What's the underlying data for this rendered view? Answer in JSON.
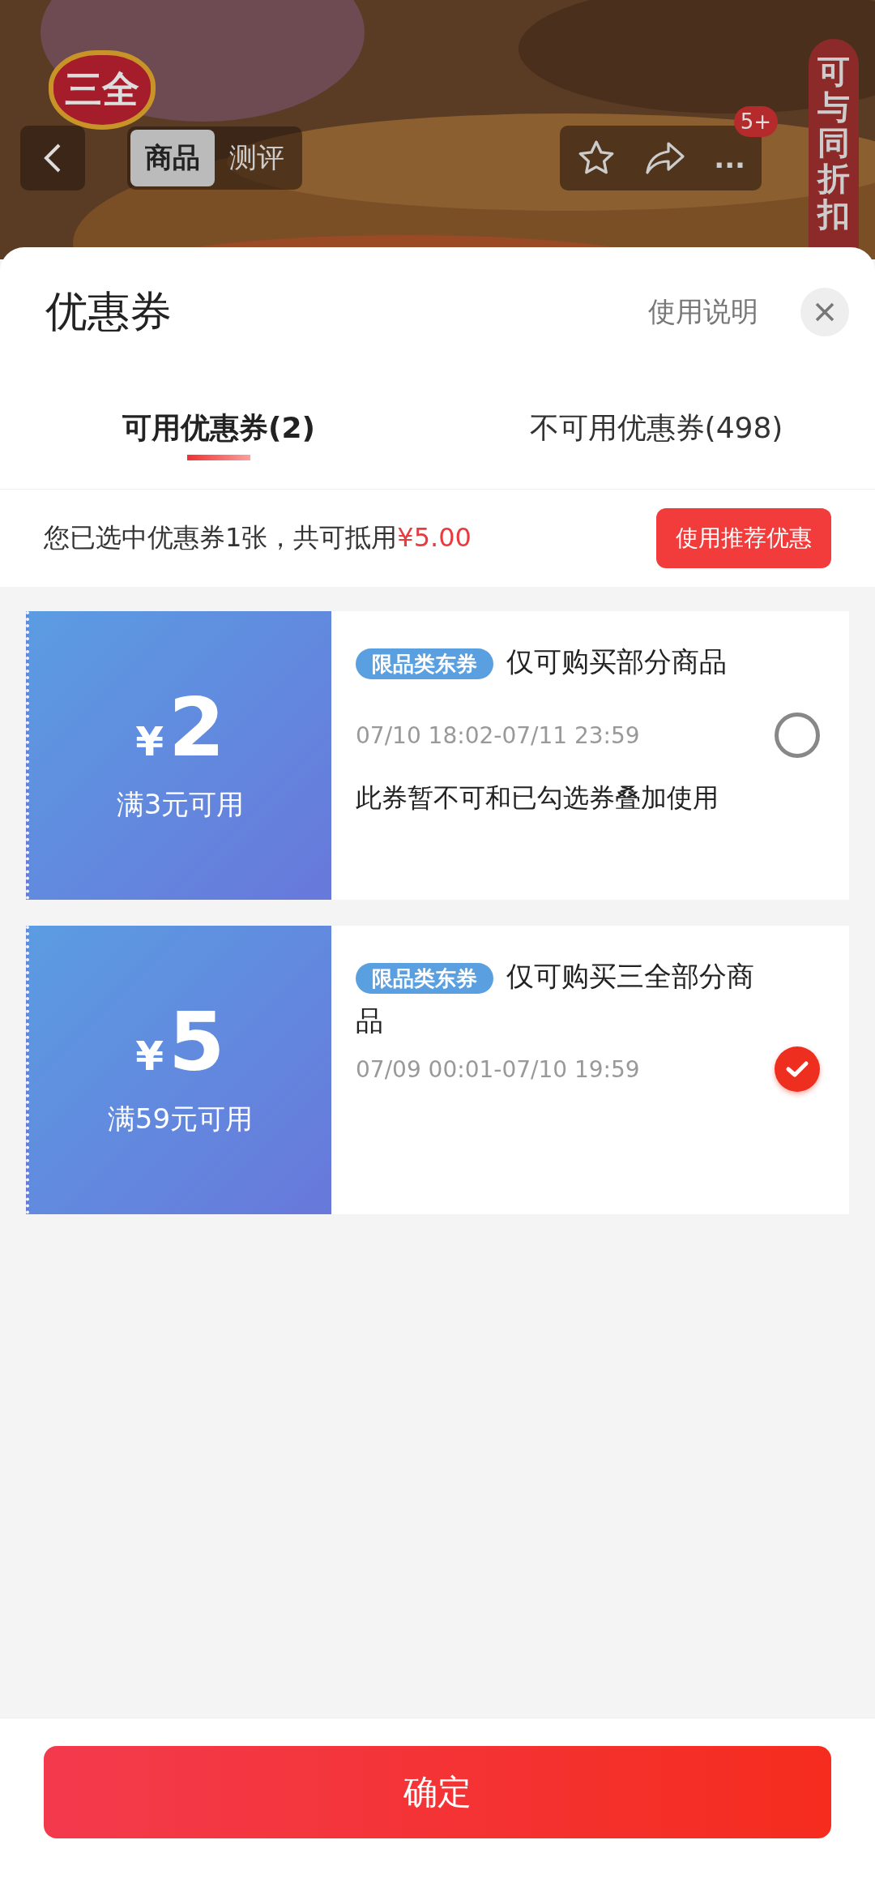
{
  "header": {
    "logo_text": "三全",
    "tabs": [
      {
        "label": "商品",
        "selected": true
      },
      {
        "label": "测评",
        "selected": false
      }
    ],
    "badge": "5+",
    "more": "...",
    "promo_tag": "可与同折扣"
  },
  "sheet": {
    "title": "优惠券",
    "help_link": "使用说明",
    "tabs": [
      {
        "label": "可用优惠券(2)",
        "selected": true
      },
      {
        "label": "不可用优惠券(498)",
        "selected": false
      }
    ],
    "summary": {
      "text": "您已选中优惠券1张，共可抵用",
      "amount": "¥5.00",
      "button": "使用推荐优惠"
    },
    "coupons": [
      {
        "currency": "¥",
        "amount": "2",
        "condition": "满3元可用",
        "tag": "限品类东券",
        "title": "仅可购买部分商品",
        "validity": "07/10 18:02-07/11 23:59",
        "note": "此券暂不可和已勾选券叠加使用",
        "selected": false
      },
      {
        "currency": "¥",
        "amount": "5",
        "condition": "满59元可用",
        "tag": "限品类东券",
        "title": "仅可购买三全部分商品",
        "validity": "07/09 00:01-07/10 19:59",
        "selected": true
      }
    ],
    "confirm": "确定"
  }
}
